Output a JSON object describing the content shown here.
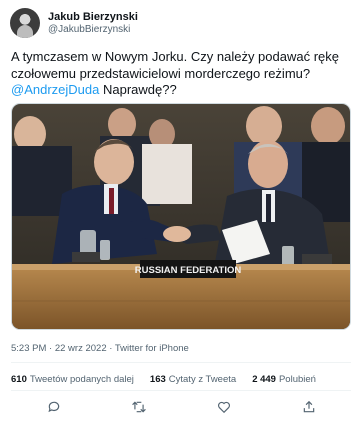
{
  "author": {
    "display_name": "Jakub Bierzynski",
    "handle": "@JakubBierzynski"
  },
  "tweet": {
    "text_before": "A tymczasem w Nowym Jorku. Czy należy podawać rękę czołowemu przedstawicielowi morderczego reżimu? ",
    "mention": "@AndrzejDuda",
    "text_after": " Naprawdę??"
  },
  "photo": {
    "placard_text": "RUSSIAN FEDERATION"
  },
  "meta": {
    "time": "5:23 PM",
    "separator1": " · ",
    "date": "22 wrz 2022",
    "separator2": " · ",
    "client": "Twitter for iPhone"
  },
  "stats": {
    "retweets_count": "610",
    "retweets_label": "Tweetów podanych dalej",
    "quotes_count": "163",
    "quotes_label": "Cytaty z Tweeta",
    "likes_count": "2 449",
    "likes_label": "Polubień"
  },
  "actions": [
    "reply-icon",
    "retweet-icon",
    "like-icon",
    "share-icon"
  ],
  "colors": {
    "accent": "#1d9bf0",
    "secondary_text": "#536471",
    "primary_text": "#0f1419"
  }
}
